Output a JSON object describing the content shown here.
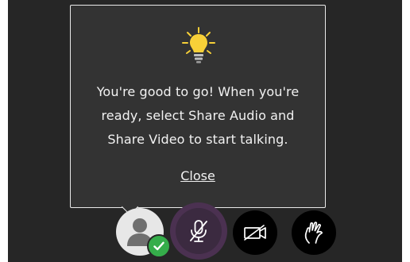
{
  "tooltip": {
    "icon": "lightbulb-icon",
    "message": "You're good to go! When you're ready, select Share Audio and Share Video to start talking.",
    "close_label": "Close"
  },
  "controls": {
    "avatar": {
      "icon": "avatar-icon",
      "status": "check-icon",
      "status_color": "#35ad4a"
    },
    "share_audio": {
      "icon": "microphone-muted-icon",
      "highlight_color": "#4b3151"
    },
    "share_video": {
      "icon": "camera-off-icon"
    },
    "raise_hand": {
      "icon": "raise-hand-icon"
    }
  },
  "colors": {
    "background": "#262626",
    "tooltip_bg": "#333333",
    "tooltip_border": "#e9e9e9",
    "bulb": "#f7d038"
  }
}
